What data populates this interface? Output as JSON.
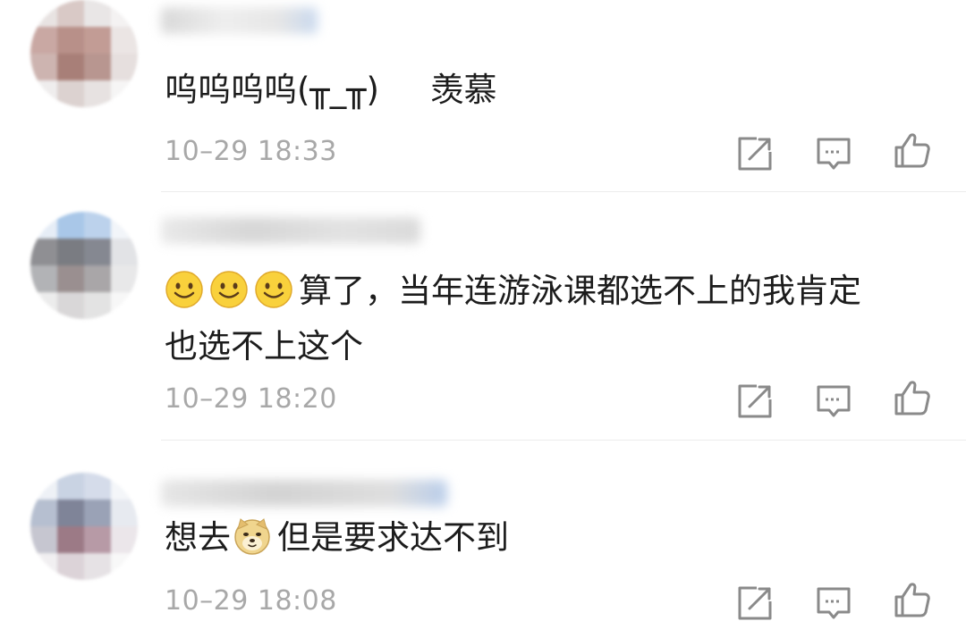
{
  "comments": [
    {
      "text_parts": [
        "呜呜呜呜(╥_╥)",
        "羡慕"
      ],
      "timestamp": "10–29 18:33"
    },
    {
      "line1_text": "算了，当年连游泳课都选不上的我肯定",
      "line2_text": "也选不上这个",
      "emoji": "smile-emoji",
      "timestamp": "10–29 18:20"
    },
    {
      "text_before": "想去",
      "emoji": "doge-emoji",
      "text_after": "但是要求达不到",
      "timestamp": "10–29 18:08"
    }
  ],
  "icons": {
    "share": "share-icon",
    "reply": "comment-icon",
    "like": "thumbs-up-icon"
  },
  "colors": {
    "text": "#1c1c1c",
    "timestamp": "#a8a8a8",
    "icon": "#8a8a8a",
    "divider": "#ececec"
  }
}
